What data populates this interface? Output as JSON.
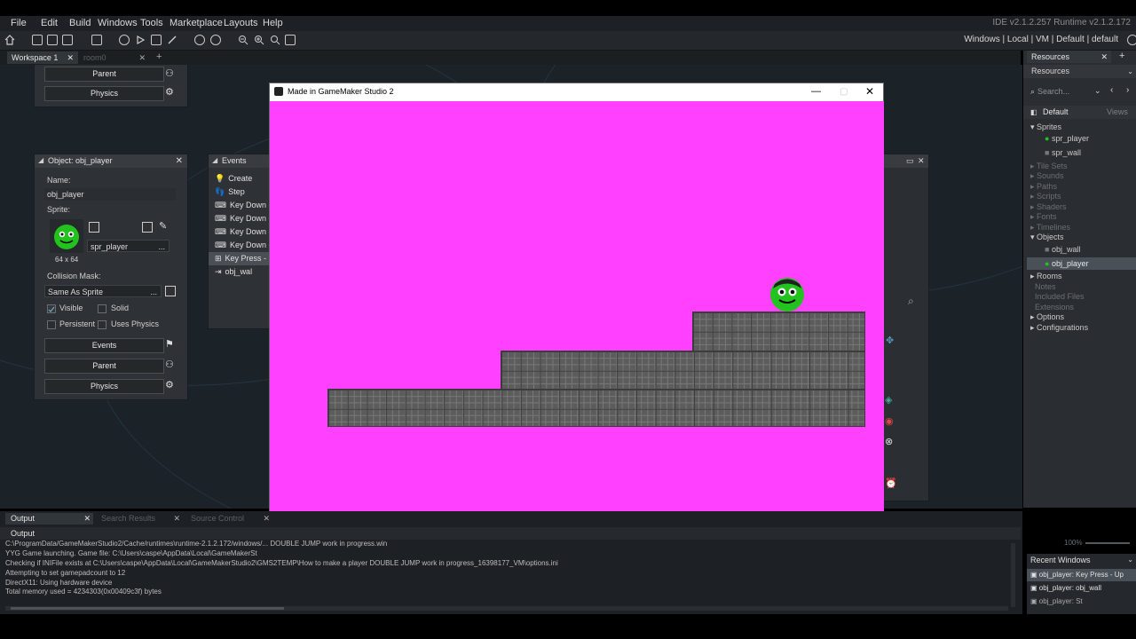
{
  "menu": {
    "items": [
      "File",
      "Edit",
      "Build",
      "Windows",
      "Tools",
      "Marketplace",
      "Layouts",
      "Help"
    ],
    "version": "IDE v2.1.2.257 Runtime v2.1.2.172"
  },
  "toolbar": {
    "right_text": "Windows | Local | VM | Default | default"
  },
  "tabs": {
    "workspace": "Workspace 1",
    "room": "room0"
  },
  "panel_top": {
    "parent_label": "Parent",
    "physics_label": "Physics"
  },
  "object_panel": {
    "title": "Object: obj_player",
    "name_label": "Name:",
    "name_value": "obj_player",
    "sprite_label": "Sprite:",
    "sprite_value": "spr_player",
    "sprite_size": "64 x 64",
    "collision_label": "Collision Mask:",
    "collision_value": "Same As Sprite",
    "more": "...",
    "visible": "Visible",
    "solid": "Solid",
    "persistent": "Persistent",
    "uses_physics": "Uses Physics",
    "events_btn": "Events",
    "parent_btn": "Parent",
    "physics_btn": "Physics"
  },
  "events_panel": {
    "title": "Events",
    "items": [
      "Create",
      "Step",
      "Key Down -",
      "Key Down -",
      "Key Down -",
      "Key Down -",
      "Key Press -",
      "obj_wal"
    ]
  },
  "game_window": {
    "title": "Made in GameMaker Studio 2",
    "bg_color": "#ff40ff"
  },
  "resources": {
    "tab": "Resources",
    "header": "Resources",
    "search_placeholder": "Search...",
    "group": "Default",
    "views": "Views",
    "sprites": "Sprites",
    "spr_player": "spr_player",
    "spr_wall": "spr_wall",
    "tile_sets": "Tile Sets",
    "sounds": "Sounds",
    "paths": "Paths",
    "scripts": "Scripts",
    "shaders": "Shaders",
    "fonts": "Fonts",
    "timelines": "Timelines",
    "objects": "Objects",
    "obj_wall": "obj_wall",
    "obj_player": "obj_player",
    "rooms": "Rooms",
    "notes": "Notes",
    "included_files": "Included Files",
    "extensions": "Extensions",
    "options": "Options",
    "configurations": "Configurations",
    "zoom": "100%"
  },
  "output": {
    "tabs": [
      "Output",
      "Search Results",
      "Source Control"
    ],
    "header": "Output",
    "lines": [
      "C:\\ProgramData/GameMakerStudio2/Cache/runtimes\\runtime-2.1.2.172/windows/...                                                                                                        DOUBLE JUMP work in progress.win",
      "YYG Game launching. Game file: C:\\Users\\caspe\\AppData\\Local\\GameMakerSt",
      "Checking if INIFile exists at C:\\Users\\caspe\\AppData\\Local\\GameMakerStudio2\\GMS2TEMP\\How to make a player DOUBLE JUMP work in progress_16398177_VM\\options.ini",
      "Attempting to set gamepadcount to 12",
      "DirectX11: Using hardware device",
      "Total memory used = 4234303(0x00409c3f) bytes"
    ]
  },
  "recent": {
    "title": "Recent Windows",
    "items": [
      "obj_player: Key Press - Up",
      "obj_player: obj_wall",
      "obj_player: St"
    ]
  }
}
